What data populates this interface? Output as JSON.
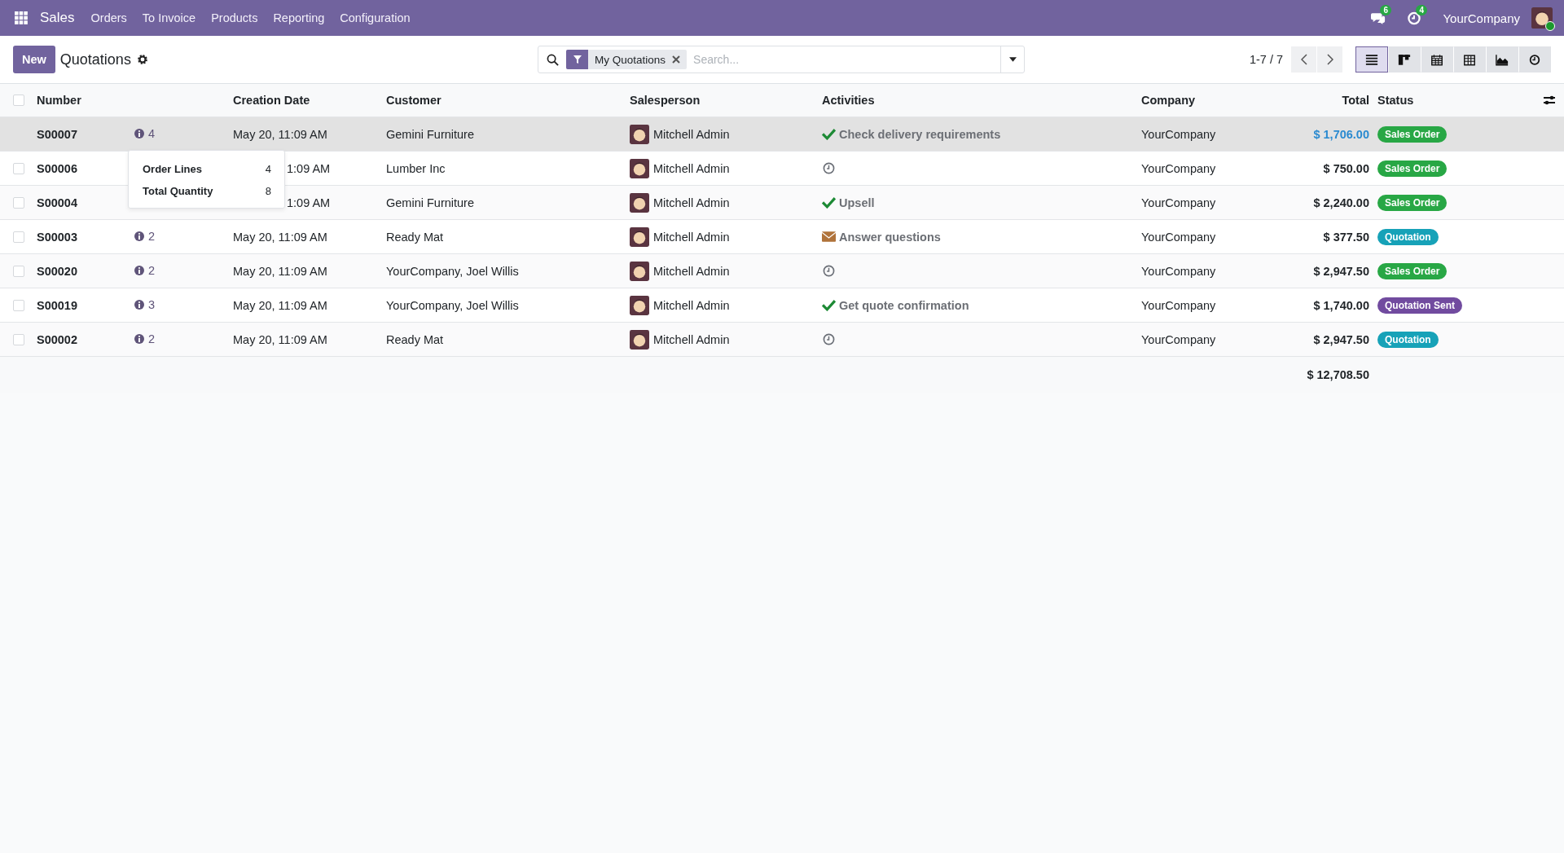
{
  "navbar": {
    "app": "Sales",
    "menu": [
      "Orders",
      "To Invoice",
      "Products",
      "Reporting",
      "Configuration"
    ],
    "messages_count": "6",
    "activities_count": "4",
    "company": "YourCompany"
  },
  "control_panel": {
    "new_button": "New",
    "title": "Quotations",
    "facet": "My Quotations",
    "search_placeholder": "Search...",
    "pager": "1-7 / 7",
    "views": [
      {
        "kind": "list",
        "selected": true
      },
      {
        "kind": "kanban",
        "selected": false
      },
      {
        "kind": "calendar",
        "selected": false
      },
      {
        "kind": "pivot",
        "selected": false
      },
      {
        "kind": "graph",
        "selected": false
      },
      {
        "kind": "activity",
        "selected": false
      }
    ]
  },
  "table": {
    "select_all_checked": false,
    "columns": [
      "Number",
      "Creation Date",
      "Customer",
      "Salesperson",
      "Activities",
      "Company",
      "Total",
      "Status"
    ],
    "rows": [
      {
        "number": "S00007",
        "info": "4",
        "date": "May 20, 11:09 AM",
        "customer": "Gemini Furniture",
        "salesperson": "Mitchell Admin",
        "activity": {
          "kind": "done",
          "label": "Check delivery requirements"
        },
        "company": "YourCompany",
        "total": "$ 1,706.00",
        "status": "Sales Order",
        "color": "#28a745",
        "highlighted": true
      },
      {
        "number": "S00006",
        "date": "1:09 AM",
        "customer": "Lumber Inc",
        "salesperson": "Mitchell Admin",
        "activity": {
          "kind": "clock"
        },
        "company": "YourCompany",
        "total": "$ 750.00",
        "status": "Sales Order",
        "color": "#28a745",
        "highlighted": false
      },
      {
        "number": "S00004",
        "date": "1:09 AM",
        "customer": "Gemini Furniture",
        "salesperson": "Mitchell Admin",
        "activity": {
          "kind": "done",
          "label": "Upsell"
        },
        "company": "YourCompany",
        "total": "$ 2,240.00",
        "status": "Sales Order",
        "color": "#28a745",
        "highlighted": false
      },
      {
        "number": "S00003",
        "info": "2",
        "date": "May 20, 11:09 AM",
        "customer": "Ready Mat",
        "salesperson": "Mitchell Admin",
        "activity": {
          "kind": "mail",
          "label": "Answer questions"
        },
        "company": "YourCompany",
        "total": "$ 377.50",
        "status": "Quotation",
        "color": "#17a2b8",
        "highlighted": false
      },
      {
        "number": "S00020",
        "info": "2",
        "date": "May 20, 11:09 AM",
        "customer": "YourCompany, Joel Willis",
        "salesperson": "Mitchell Admin",
        "activity": {
          "kind": "clock"
        },
        "company": "YourCompany",
        "total": "$ 2,947.50",
        "status": "Sales Order",
        "color": "#28a745",
        "highlighted": false
      },
      {
        "number": "S00019",
        "info": "3",
        "date": "May 20, 11:09 AM",
        "customer": "YourCompany, Joel Willis",
        "salesperson": "Mitchell Admin",
        "activity": {
          "kind": "done",
          "label": "Get quote confirmation"
        },
        "company": "YourCompany",
        "total": "$ 1,740.00",
        "status": "Quotation Sent",
        "color": "#714b9f",
        "highlighted": false
      },
      {
        "number": "S00002",
        "info": "2",
        "date": "May 20, 11:09 AM",
        "customer": "Ready Mat",
        "salesperson": "Mitchell Admin",
        "activity": {
          "kind": "clock"
        },
        "company": "YourCompany",
        "total": "$ 2,947.50",
        "status": "Quotation",
        "color": "#17a2b8",
        "highlighted": false
      }
    ],
    "sum_total": "$ 12,708.50"
  },
  "tooltip": {
    "lines": [
      {
        "label": "Order Lines",
        "value": "4"
      },
      {
        "label": "Total Quantity",
        "value": "8"
      }
    ]
  }
}
